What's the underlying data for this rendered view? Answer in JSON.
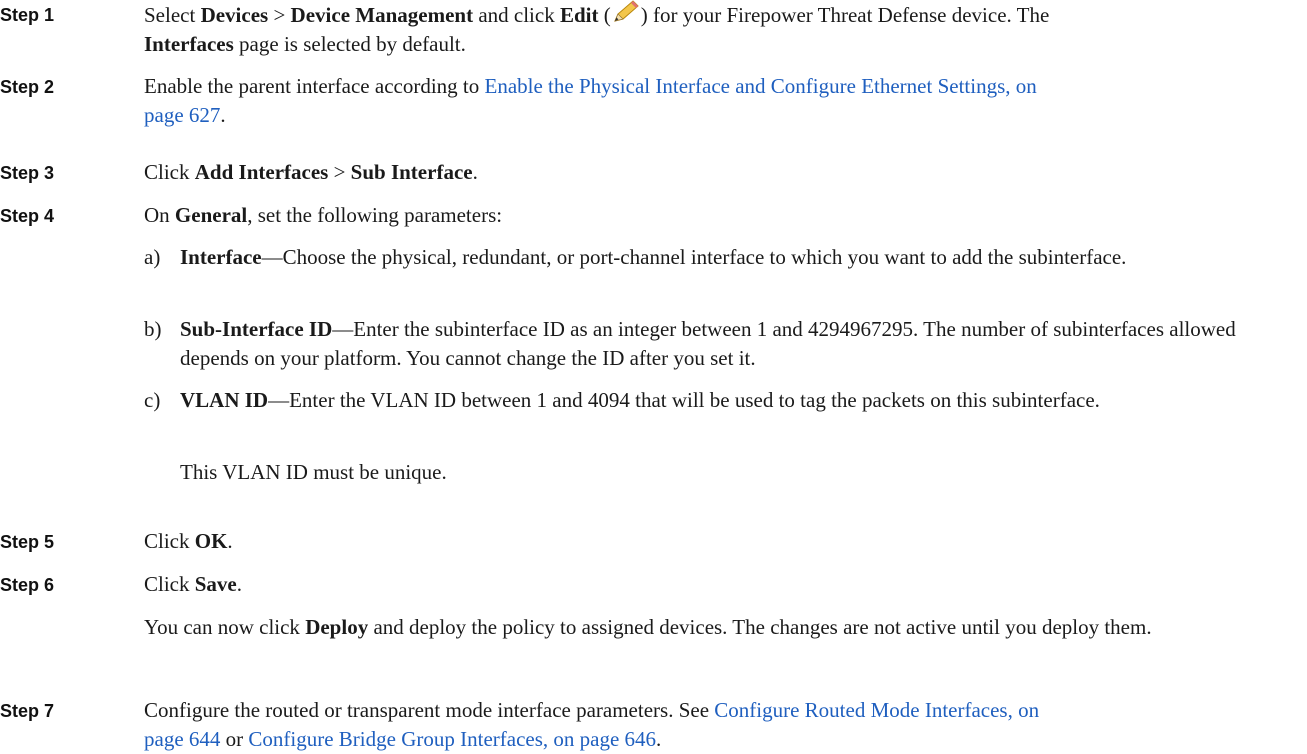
{
  "steps": [
    {
      "label": "Step 1",
      "t1": "Select ",
      "b1": "Devices",
      "t2": " > ",
      "b2": "Device Management",
      "t3": " and click ",
      "b3": "Edit",
      "t4": " (",
      "icon": "pencil-edit-icon",
      "t5": ") for your Firepower Threat Defense device. The",
      "b4": "Interfaces",
      "t6": " page is selected by default."
    },
    {
      "label": "Step 2",
      "t1": "Enable the parent interface according to ",
      "link1": "Enable the Physical Interface and Configure Ethernet Settings, on",
      "link2": "page 627",
      "t2": "."
    },
    {
      "label": "Step 3",
      "t1": "Click ",
      "b1": "Add Interfaces",
      "t2": " > ",
      "b2": "Sub Interface",
      "t3": "."
    },
    {
      "label": "Step 4",
      "t1": "On ",
      "b1": "General",
      "t2": ", set the following parameters:",
      "items": [
        {
          "letter": "a)",
          "bold": "Interface",
          "text": "—Choose the physical, redundant, or port-channel interface to which you want to add the subinterface."
        },
        {
          "letter": "b)",
          "bold": "Sub-Interface ID",
          "text": "—Enter the subinterface ID as an integer between 1 and 4294967295. The number of subinterfaces allowed depends on your platform. You cannot change the ID after you set it."
        },
        {
          "letter": "c)",
          "bold": "VLAN ID",
          "text": "—Enter the VLAN ID between 1 and 4094 that will be used to tag the packets on this subinterface."
        }
      ],
      "note": "This VLAN ID must be unique."
    },
    {
      "label": "Step 5",
      "t1": "Click ",
      "b1": "OK",
      "t2": "."
    },
    {
      "label": "Step 6",
      "t1": "Click ",
      "b1": "Save",
      "t2": ".",
      "p1": "You can now click ",
      "pb": "Deploy",
      "p2": " and deploy the policy to assigned devices. The changes are not active until you deploy them."
    },
    {
      "label": "Step 7",
      "t1": "Configure the routed or transparent mode interface parameters. See ",
      "link1": "Configure Routed Mode Interfaces, on",
      "link2": "page 644",
      "t2": " or ",
      "link3": "Configure Bridge Group Interfaces, on page 646",
      "t3": "."
    }
  ]
}
